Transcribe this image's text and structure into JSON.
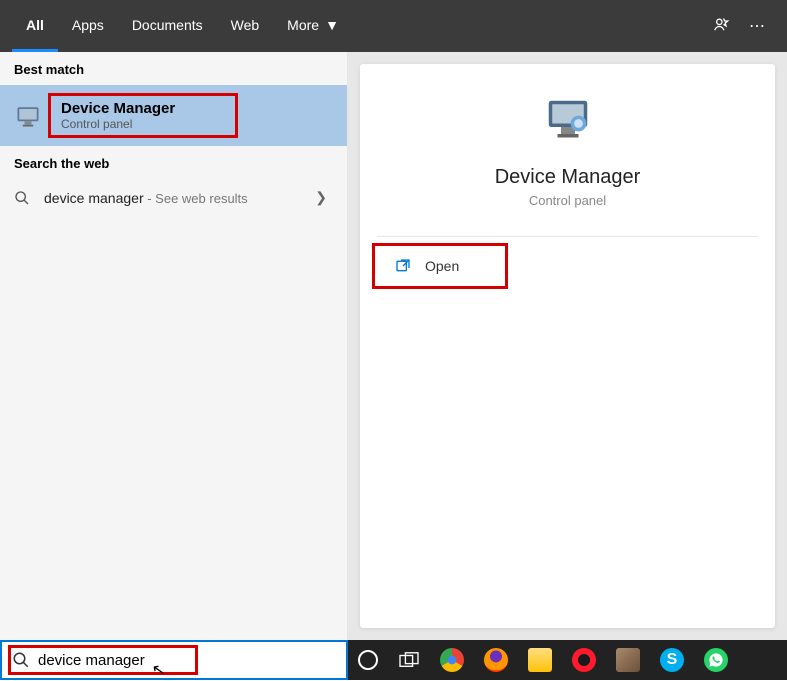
{
  "topbar": {
    "tabs": {
      "all": "All",
      "apps": "Apps",
      "documents": "Documents",
      "web": "Web",
      "more": "More"
    }
  },
  "left": {
    "best_match_header": "Best match",
    "result": {
      "title": "Device Manager",
      "subtitle": "Control panel"
    },
    "web_header": "Search the web",
    "web_result": {
      "query": "device manager",
      "suffix": " - See web results"
    }
  },
  "detail": {
    "title": "Device Manager",
    "subtitle": "Control panel",
    "open": "Open"
  },
  "search": {
    "value": "device manager"
  },
  "tray": {
    "skype_glyph": "S"
  }
}
